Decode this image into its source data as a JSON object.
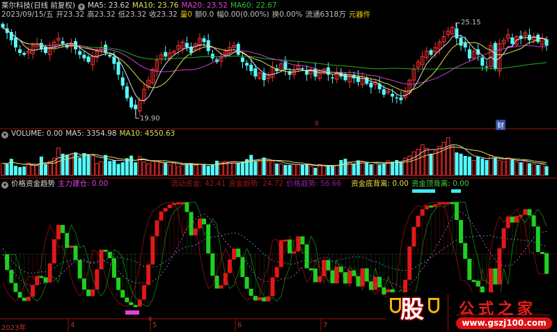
{
  "header": {
    "title": "莱尔科技(日线 前复权)",
    "ma5": "MA5: 23.62",
    "ma10": "MA10: 23.76",
    "ma20": "MA20: 23.52",
    "ma60": "MA60: 22.67",
    "date": "2023/09/15/五",
    "open": "开23.32",
    "high": "高23.32",
    "low": "低23.32",
    "close": "收23.32",
    "vol_label": "量",
    "vol_value": "0",
    "amount": "额0.0",
    "change": "幅0.00(0.00%)",
    "turnover": "换0.00%",
    "float": "流通6318万",
    "sector": "元器件"
  },
  "volume_header": {
    "volume": "VOLUME: 0.00",
    "ma5": "MA5: 3354.98",
    "ma10": "MA10: 4550.63"
  },
  "indicator_header": {
    "name": "价格资金趋势",
    "main_build": "主力建仓: 0.00",
    "liquid_funds": "流动资金: 42.41",
    "fund_trend": "资金趋势: 24.72",
    "price_trend": "价格趋势: 56.66",
    "bottom_div": "资金底背离: 0.00",
    "top_div": "资金顶背离: 0.00"
  },
  "annotations": {
    "high_label": "25.15",
    "low_label": "19.90",
    "event_mark": "8",
    "finance_mark": "财",
    "axis_mark": "8"
  },
  "x_axis": [
    "2023年",
    "4",
    "5",
    "6",
    "7"
  ],
  "logo": {
    "char": "股",
    "name": "公式之家",
    "url": "www.gszj100.com"
  },
  "colors": {
    "up": "#ff3030",
    "down": "#54fcfc",
    "ma5": "#e0e0e0",
    "ma10": "#e0e050",
    "ma20": "#d040d0",
    "ma60": "#20b020"
  },
  "chart_data": {
    "type": "candlestick",
    "price_range": [
      19.44,
      25.57
    ],
    "closes": [
      24.9,
      24.6,
      24.2,
      23.8,
      23.5,
      23.4,
      23.6,
      23.9,
      24.0,
      23.7,
      23.5,
      23.8,
      24.1,
      24.3,
      24.0,
      23.8,
      24.0,
      23.7,
      23.4,
      23.2,
      23.0,
      23.3,
      23.6,
      23.8,
      23.5,
      23.3,
      22.9,
      22.3,
      21.7,
      21.0,
      20.5,
      20.4,
      20.9,
      21.5,
      22.0,
      22.6,
      23.1,
      23.4,
      23.3,
      23.5,
      23.6,
      23.9,
      24.1,
      23.8,
      23.5,
      24.0,
      24.3,
      24.1,
      23.6,
      23.2,
      23.0,
      23.3,
      23.6,
      23.8,
      23.9,
      23.4,
      23.0,
      22.8,
      22.5,
      22.2,
      22.4,
      22.0,
      22.3,
      22.7,
      22.5,
      22.9,
      22.6,
      22.3,
      22.5,
      22.8,
      22.6,
      22.3,
      22.5,
      22.2,
      22.4,
      22.6,
      22.3,
      22.1,
      22.4,
      22.2,
      22.0,
      22.3,
      22.1,
      21.9,
      22.2,
      21.8,
      21.6,
      21.9,
      21.5,
      21.2,
      21.4,
      21.1,
      21.0,
      20.9,
      21.4,
      22.0,
      22.6,
      23.0,
      23.3,
      23.6,
      23.4,
      23.8,
      24.1,
      24.4,
      24.7,
      24.9,
      24.3,
      23.9,
      23.8,
      23.2,
      23.6,
      23.4,
      22.8,
      22.7,
      23.9,
      22.6,
      24.0,
      24.2,
      24.5,
      24.0,
      24.4,
      24.3,
      24.6,
      24.2,
      24.4,
      24.1,
      24.3,
      23.9
    ],
    "volumes": [
      3800,
      3600,
      5200,
      3000,
      2600,
      2800,
      3900,
      3400,
      3100,
      5900,
      3500,
      4400,
      5400,
      8600,
      6800,
      6500,
      6600,
      7200,
      5600,
      7000,
      6500,
      6200,
      3800,
      4300,
      6400,
      4500,
      4700,
      3600,
      4100,
      5400,
      6200,
      4100,
      5900,
      4200,
      3600,
      4600,
      4200,
      4000,
      3900,
      3300,
      4100,
      2800,
      3300,
      3600,
      3800,
      3100,
      3500,
      3400,
      3000,
      3300,
      4600,
      4200,
      4400,
      4300,
      4200,
      3900,
      4300,
      5100,
      6400,
      4400,
      4700,
      5600,
      4300,
      4500,
      3700,
      3600,
      3300,
      3300,
      3500,
      3400,
      3300,
      3500,
      2800,
      2400,
      3400,
      3100,
      3000,
      2900,
      3200,
      4800,
      5200,
      4200,
      3700,
      4700,
      4300,
      3900,
      3500,
      3600,
      3400,
      3800,
      4600,
      4300,
      4800,
      4200,
      5400,
      6100,
      7400,
      8200,
      9600,
      8500,
      6800,
      7700,
      9100,
      10400,
      11800,
      9200,
      7200,
      6800,
      6100,
      5900,
      4700,
      5900,
      5300,
      4800,
      6300,
      5500,
      4800,
      4400,
      5500,
      4900,
      4300,
      4100,
      4500,
      3800,
      3600,
      3300,
      3500,
      2900
    ]
  }
}
